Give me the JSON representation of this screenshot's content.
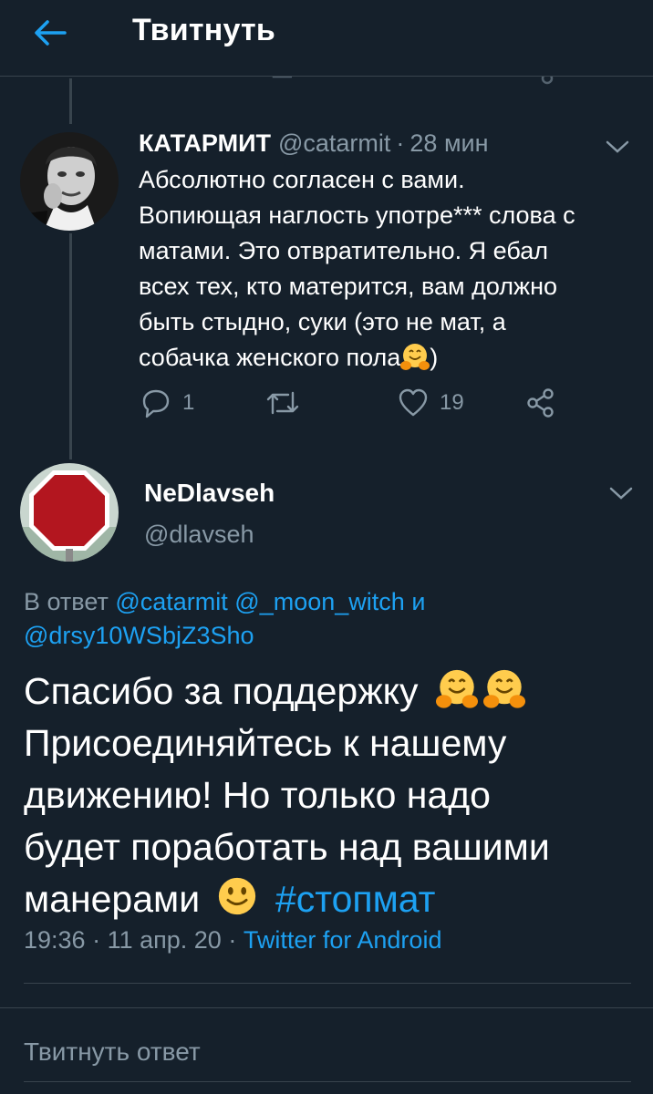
{
  "header": {
    "title": "Твитнуть"
  },
  "tweet1": {
    "display_name": "КАТАРМИТ",
    "handle": "@catarmit",
    "separator": "·",
    "time": "28 мин",
    "lines": [
      "Абсолютно согласен с вами.",
      "Вопиющая наглость употре*** слова с",
      "матами. Это отвратительно. Я ебал",
      "всех тех, кто матерится, вам должно",
      "быть стыдно, суки (это не мат, а",
      "собачка женского пола"
    ],
    "line_end": ")",
    "replies": "1",
    "likes": "19"
  },
  "tweet2": {
    "display_name": "NeDlavseh",
    "handle": "@dlavseh",
    "reply_prefix": "В ответ",
    "mention1": "@catarmit",
    "mention2": "@_moon_witch",
    "reply_and": "и",
    "mention3": "@drsy10WSbjZ3Sho",
    "text_line1": "Спасибо за поддержку",
    "text_line2": "Присоединяйтесь к нашему",
    "text_line3": "движению! Но только надо",
    "text_line4": "будет поработать над вашими",
    "text_line5": "манерами",
    "hashtag": "#стопмат",
    "time": "19:36",
    "sep": "·",
    "date": "11 апр. 20",
    "client": "Twitter for Android"
  },
  "reply_box": {
    "placeholder": "Твитнуть ответ"
  },
  "colors": {
    "background": "#15202b",
    "accent": "#1da1f2",
    "secondary_text": "#8899a6",
    "divider": "#38444d"
  }
}
